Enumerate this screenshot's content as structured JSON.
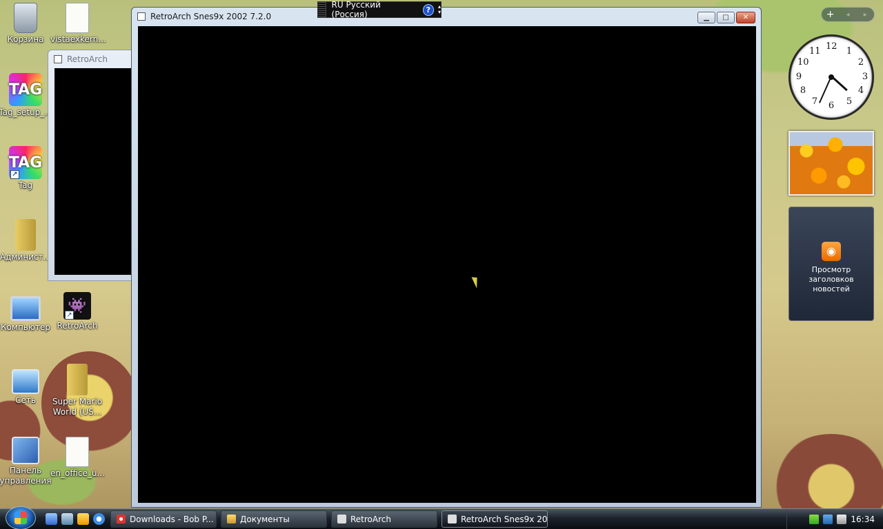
{
  "desktop": {
    "icons": [
      {
        "label": "Корзина",
        "icon": "recycle-bin-icon"
      },
      {
        "label": "vistaexkern...",
        "icon": "file-icon"
      },
      {
        "label": "Tag_setup_...",
        "icon": "tag-setup-icon"
      },
      {
        "label": "Tag",
        "icon": "tag-icon"
      },
      {
        "label": "Админист...",
        "icon": "folder-icon"
      },
      {
        "label": "Компьютер",
        "icon": "computer-icon"
      },
      {
        "label": "RetroArch",
        "icon": "retroarch-icon"
      },
      {
        "label": "Сеть",
        "icon": "network-icon"
      },
      {
        "label": "Super Mario World (US...",
        "icon": "zip-folder-icon"
      },
      {
        "label": "Панель управления",
        "icon": "control-panel-icon"
      },
      {
        "label": "en_office_u...",
        "icon": "file-icon"
      }
    ]
  },
  "language_bar": {
    "label": "RU Русский (Россия)",
    "help": "?"
  },
  "windows": {
    "background_window": {
      "title": "RetroArch"
    },
    "main_window": {
      "title": "RetroArch Snes9x 2002 7.2.0"
    }
  },
  "sidebar": {
    "add": "+",
    "prev": "◂",
    "next": "▸",
    "clock_numbers": [
      "12",
      "1",
      "2",
      "3",
      "4",
      "5",
      "6",
      "7",
      "8",
      "9",
      "10",
      "11"
    ],
    "feed_gadget_text": "Просмотр заголовков новостей"
  },
  "taskbar": {
    "buttons": [
      {
        "label": "Downloads - Bob P...",
        "icon": "browser-icon"
      },
      {
        "label": "Документы",
        "icon": "folder-icon"
      },
      {
        "label": "RetroArch",
        "icon": "retroarch-icon"
      },
      {
        "label": "RetroArch Snes9x 20...",
        "icon": "retroarch-icon",
        "active": true
      }
    ],
    "clock": "16:34"
  },
  "colors": {
    "window_frame": "#bccadb",
    "window_content": "#000000",
    "taskbar": "#1c232b",
    "close_button": "#c2432a"
  }
}
